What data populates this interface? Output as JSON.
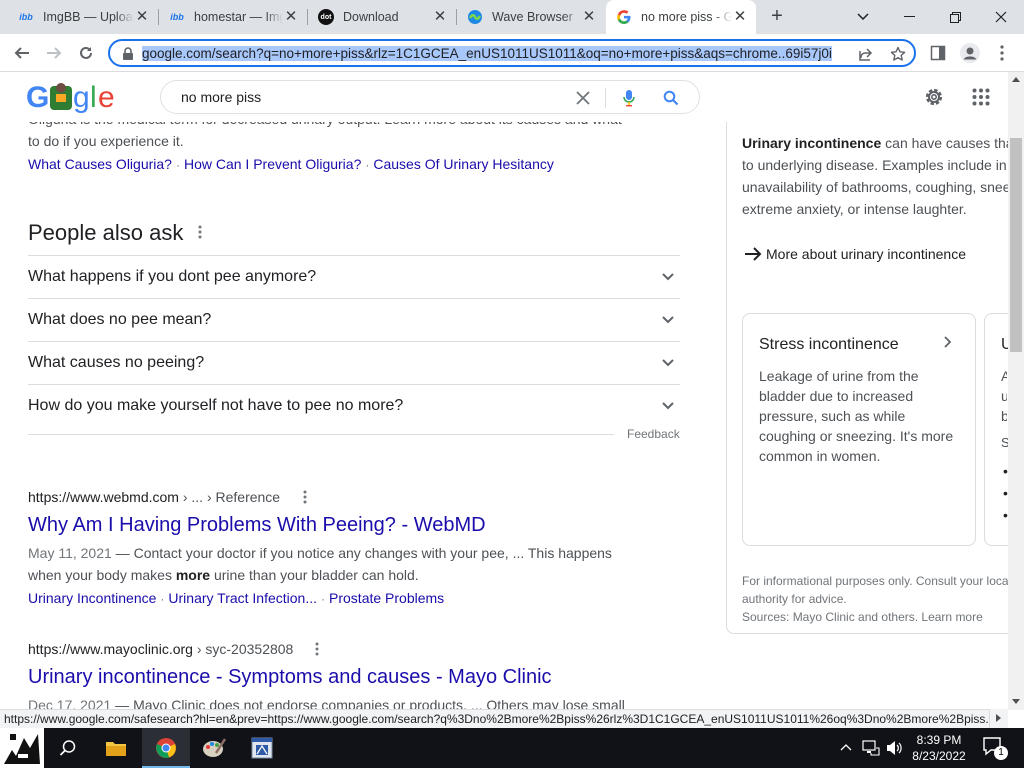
{
  "browser": {
    "tabs": [
      {
        "title": "ImgBB — Upload Image",
        "favicon": "ibb"
      },
      {
        "title": "homestar — ImgBB",
        "favicon": "ibb"
      },
      {
        "title": "Download",
        "favicon": "dot"
      },
      {
        "title": "Wave Browser",
        "favicon": "wave"
      },
      {
        "title": "no more piss - Google Search",
        "favicon": "G",
        "active": true
      }
    ],
    "new_tab_label": "+",
    "url": "google.com/search?q=no+more+piss&rlz=1C1GCEA_enUS1011US1011&oq=no+more+piss&aqs=chrome..69i57j0i",
    "status_url": "https://www.google.com/safesearch?hl=en&prev=https://www.google.com/search?q%3Dno%2Bmore%2Bpiss%26rlz%3D1C1GCEA_enUS1011US1011%26oq%3Dno%2Bmore%2Bpiss..."
  },
  "google": {
    "logo_text": "Google",
    "query": "no more piss"
  },
  "top_result": {
    "snippet_partial": "Oliguria is the medical term for decreased urinary output. Learn more about its causes and what",
    "snippet_line2": "to do if you experience it.",
    "sitelinks": [
      "What Causes Oliguria?",
      "How Can I Prevent Oliguria?",
      "Causes Of Urinary Hesitancy"
    ]
  },
  "paa": {
    "heading": "People also ask",
    "questions": [
      "What happens if you dont pee anymore?",
      "What does no pee mean?",
      "What causes no peeing?",
      "How do you make yourself not have to pee no more?"
    ],
    "feedback": "Feedback"
  },
  "results": [
    {
      "site": "https://www.webmd.com",
      "breadcrumb": "› ... › Reference",
      "title": "Why Am I Having Problems With Peeing? - WebMD",
      "date": "May 11, 2021",
      "snippet_a": "Contact your doctor if you notice any changes with your pee, ... This happens",
      "snippet_b1": "when your body makes ",
      "snippet_bold": "more",
      "snippet_b2": " urine than your bladder can hold.",
      "sitelinks": [
        "Urinary Incontinence",
        "Urinary Tract Infection...",
        "Prostate Problems"
      ]
    },
    {
      "site": "https://www.mayoclinic.org",
      "breadcrumb": "› syc-20352808",
      "title": "Urinary incontinence - Symptoms and causes - Mayo Clinic",
      "date": "Dec 17, 2021",
      "snippet_a": "Mayo Clinic does not endorse companies or products. ... Others may lose small"
    }
  ],
  "knowledge_panel": {
    "bold_term": "Urinary incontinence",
    "text_1": " can have causes that",
    "text_2": "to underlying disease. Examples include in",
    "text_3": "unavailability of bathrooms, coughing, snee",
    "text_4": "extreme anxiety, or intense laughter.",
    "more_link": "More about urinary incontinence",
    "card_title": "Stress incontinence",
    "card_text": [
      "Leakage of urine from the",
      "bladder due to increased",
      "pressure, such as while",
      "coughing or sneezing. It's more",
      "common in women."
    ],
    "card2_title": "U",
    "disclaimer_1": "For informational purposes only. Consult your loca",
    "disclaimer_2": "authority for advice.",
    "sources": "Sources: Mayo Clinic and others. Learn more"
  },
  "taskbar": {
    "time": "8:39 PM",
    "date": "8/23/2022",
    "notification_count": "1"
  },
  "colors": {
    "link": "#1a0dab",
    "accent": "#1a73e8",
    "taskbar": "#101217"
  }
}
